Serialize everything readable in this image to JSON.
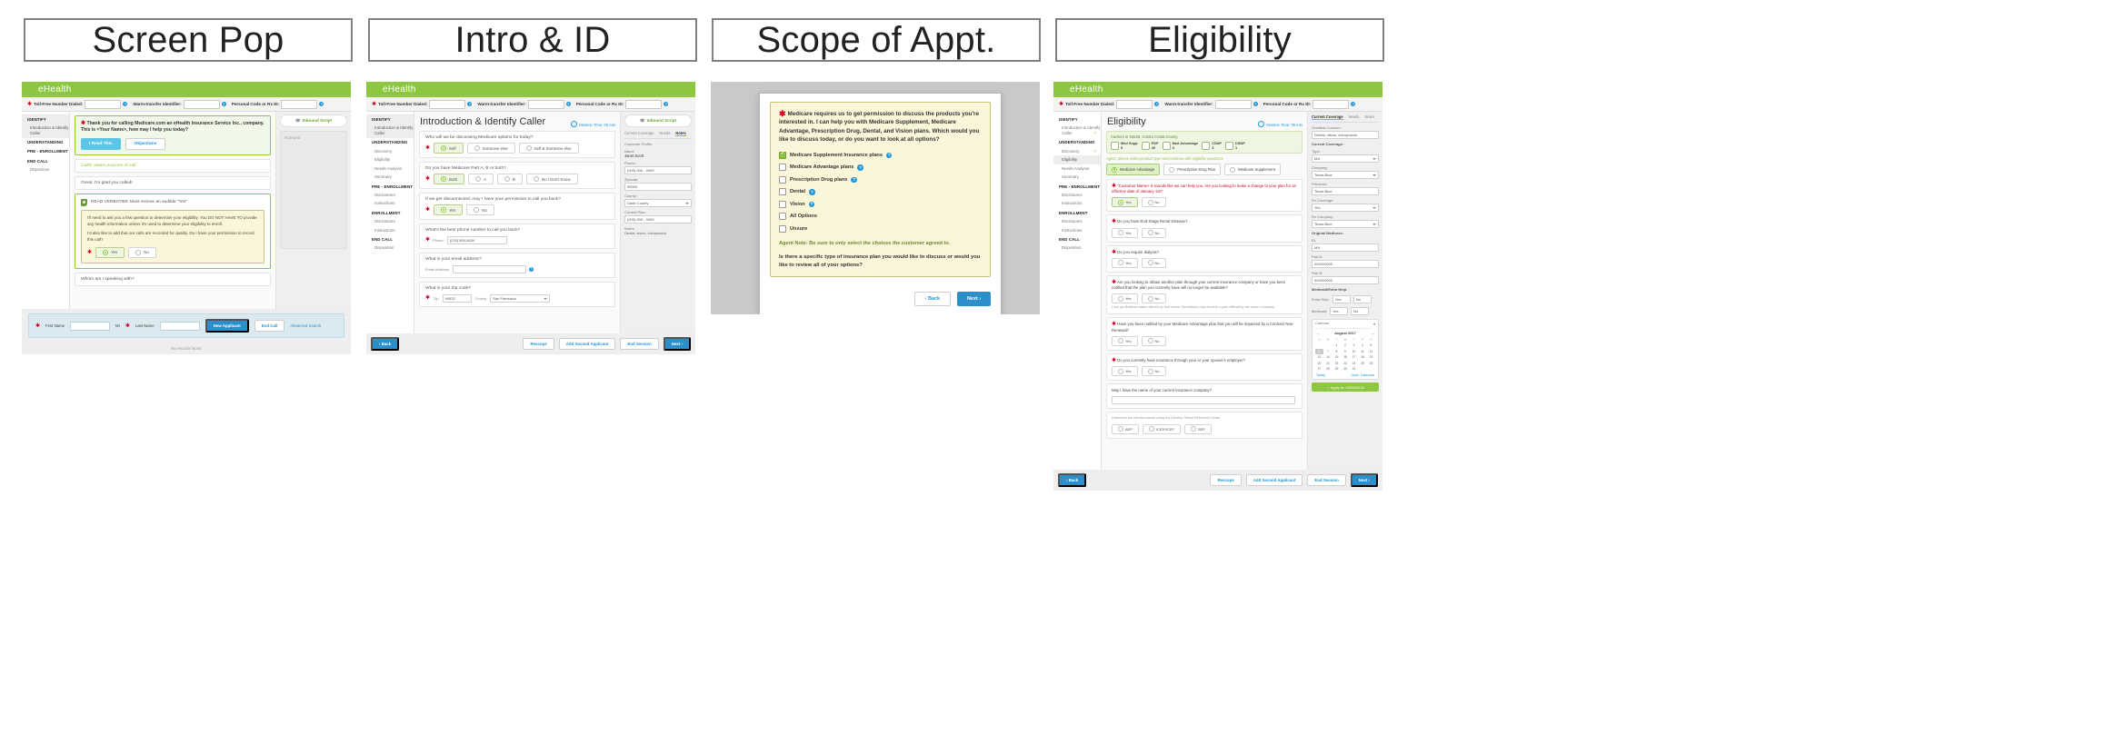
{
  "headers": [
    {
      "label": "Screen Pop"
    },
    {
      "label": "Intro & ID"
    },
    {
      "label": "Scope of Appt."
    },
    {
      "label": "Eligibility"
    }
  ],
  "brand": "eHealth",
  "topbar": {
    "toll_free_label": "Toll-Free Number Dialed:",
    "warm_transfer_label": "Warm-transfer Identifier:",
    "personal_code_label": "Personal Code or Rx ID:",
    "help_icon": "question-mark-icon"
  },
  "nav": {
    "identify": "IDENTIFY",
    "intro_identify": "Introduction & Identify Caller",
    "understanding": "UNDERSTANDING",
    "discovery": "Discovery",
    "eligibility": "Eligibility",
    "needs_analysis": "Needs Analysis",
    "summary": "Summary",
    "pre_enrollment": "PRE - ENROLLMENT",
    "disclosures": "Disclosures",
    "instructions": "Instructions",
    "enrollment": "ENROLLMENT",
    "end_call": "END CALL",
    "disposition": "Disposition"
  },
  "panel1": {
    "greeting": "Thank you for calling Medicare.com an eHealth Insurance Service Inc., company. This is <Your Name>, how may I help you today?",
    "btn_read": "I Read This",
    "btn_objections": "Objections",
    "caller_purpose": "Caller states purpose of call",
    "glad": "Great, I'm glad you called!",
    "verbatim": "READ VERBATIM!: Must recieve an audible \"Yes\"",
    "yellow_p1": "I'll need to ask you a few question to determine your eligibility. You DO NOT HAVE TO provide any health information unless it's used to determine your eligibility to enroll.",
    "yellow_p2": "I'd also like to add that our calls are recorded for quality. Do I have your permission to record this call?",
    "yes": "Yes",
    "no": "No",
    "whom": "Whom am I speaking with?",
    "search": {
      "first_name": "First Name",
      "mi": "MI",
      "last_name": "Last Name",
      "new_applicant": "New Applicant",
      "end_call": "End Call",
      "advanced_search": "Advanced Search"
    },
    "no_records": "No records found",
    "inbound_script": "Inbound Script",
    "notepad": "Notepad"
  },
  "panel2": {
    "title": "Introduction & Identify Caller",
    "session_time": "Session Time: 05 min",
    "q_discussing": "Who will we be discussing Medicare options for today?",
    "opt_self": "Self",
    "opt_someone": "Someone else",
    "opt_self_someone": "Self & Someone else",
    "q_partab": "Do you have Medicare Part A, B or both?",
    "opt_both": "Both",
    "opt_a": "A",
    "opt_b": "B",
    "opt_nodk": "No / Don't Know",
    "q_disconnect": "If we get disconnected, may I have your permission to call you back?",
    "q_bestphone": "What's the best phone number to call you back?",
    "phone_label": "Phone:",
    "phone_value": "(215) 555-5434",
    "q_email": "What is your email address?",
    "email_label": "Email Address:",
    "q_zip": "What is your Zip code?",
    "zip_label": "Zip",
    "zip_value": "94532",
    "county_label": "County",
    "county_value": "San Francisco",
    "footer": {
      "back": "Back",
      "rescope": "Rescope",
      "add_second": "Add Second Applicant",
      "end_call": "End Session",
      "next": "Next"
    },
    "right": {
      "tab_current_coverage": "Current Coverage",
      "tab_needs": "Needs",
      "tab_notes": "Notes",
      "customer_profile": "Customer Profile:",
      "name_label": "Name",
      "name_value": "Janet Scott",
      "phone_label": "Phone:",
      "phone_value": "(000) 000 - 0000",
      "zipcode_label": "Zipcode:",
      "zipcode_value": "90000",
      "county_label": "County:",
      "county_value": "Dade County",
      "current_plan": "Current Plan:",
      "current_plan_value": "(000) 000 - 0000",
      "notes_label": "Notes:",
      "notes_value": "Dental, vision, chiropractor",
      "inbound_script": "Inbound Script"
    }
  },
  "panel3": {
    "modal_title": "Medicare requires us to get permission to discuss the products you're interested in.  I can help you with Medicare Supplement, Medicare Advantage, Prescription Drug, Dental, and Vision plans.  Which would you like to discuss today, or do you want to look at all options?",
    "options": [
      {
        "label": "Medicare Supplement Insurance plans",
        "checked": true
      },
      {
        "label": "Medicare Advantage plans",
        "checked": false
      },
      {
        "label": "Prescription Drug plans",
        "checked": false
      },
      {
        "label": "Dental",
        "checked": false
      },
      {
        "label": "Vision",
        "checked": false
      },
      {
        "label": "All Options",
        "checked": false
      },
      {
        "label": "Unsure",
        "checked": false
      }
    ],
    "agent_note": "Agent Note: Be sure to only select the choices the customer agreed to.",
    "question": "Is there a specific type of insurance plan you would like to discuss or would you like to review all of your options?",
    "btn_back": "Back",
    "btn_next": "Next"
  },
  "panel4": {
    "title": "Eligibility",
    "session_time": "Session Time: 05 min",
    "coverage_title": "Carriers in 94526, Contra Costa County",
    "coverage_items": [
      {
        "name": "Med Supp",
        "count": "5",
        "icon": "document-icon"
      },
      {
        "name": "PDP",
        "count": "40",
        "icon": "pill-icon"
      },
      {
        "name": "Med Advantage",
        "count": "3",
        "icon": "wheel-icon"
      },
      {
        "name": "CSNP",
        "count": "3",
        "icon": "briefcase-icon"
      },
      {
        "name": "DSNP",
        "count": "1",
        "icon": "shield-icon"
      }
    ],
    "hint": "Agent, please select product type and continue with eligibility questions",
    "products": [
      {
        "label": "Medicare Advantage",
        "selected": true
      },
      {
        "label": "Prescription Drug Plan",
        "selected": false
      },
      {
        "label": "Medicare Supplement",
        "selected": false
      }
    ],
    "q1": "\"Customer Name> It sounds like we can help you. Are you looking to make a change to your plan for an effective date of January 1st?",
    "q2": "Do you have End-Stage Renal Disease?",
    "q3": "Do you require dialysis?",
    "q4": "Are you looking to obtain another plan through your current insurance company or have you been notified that the plan you currently have will no longer be available?",
    "q4_note": "Look up Medicare plans offered by that carrier. Beneficiary may enroll in a plan offered by the same Company.",
    "q5": "Have you been notified by your Medicare Advantage plan that you will be impacted by a Contract Non-Renewal?",
    "q6": "Do you currently have insurance through your or your spouse's employer?",
    "q7": "May I have the name of your current insurance company?",
    "q7_note": "Determine the election period using the Election Period Reference Guide.",
    "chips": [
      "AEP",
      "ICEP/ICEP",
      "SEP"
    ],
    "yes": "Yes",
    "no": "No",
    "right": {
      "tab_current_coverage": "Current Coverage",
      "tab_needs": "Needs",
      "tab_notes": "Notes",
      "greatest_concern": "Greatest Concern:",
      "greatest_concern_value": "Dental, vision, chiropractor",
      "current_coverage": "Current Coverage:",
      "type_label": "Type:",
      "type_value": "MA",
      "company_label": "Company:",
      "company_value": "Texas Blue",
      "premium_label": "Premium:",
      "premium_value": "Texas Blue",
      "rx_coverage_label": "Rx Coverage:",
      "rx_coverage_value": "Yes",
      "rx_company_label": "Rx Company:",
      "rx_company_value": "Texas Blue",
      "original_medicare": "Original Medicare:",
      "id_label": "ID:",
      "id_value": "MA",
      "part_a_label": "Part A:",
      "part_a_value": "00/00/0000",
      "part_b_label": "Part B:",
      "part_b_value": "00/00/0000",
      "extra_help_title": "Medicaid/Extra Help:",
      "extra_help_label": "Extra Help:",
      "medicaid_label": "Medicaid:",
      "yes": "Yes",
      "no": "No",
      "calendar_label": "Calendar",
      "month": "August 2017",
      "dows": [
        "S",
        "M",
        "T",
        "W",
        "T",
        "F",
        "S"
      ],
      "today": "Today",
      "open_calendar": "Open Calendar",
      "apply_for": "Apply for 00/00/2018"
    },
    "footer": {
      "back": "Back",
      "rescope": "Rescope",
      "add_second": "Add Second Applicant",
      "end_call": "End Session",
      "next": "Next"
    }
  },
  "colors": {
    "brand_green": "#8dc63f",
    "accent_blue": "#2196d6",
    "required_red": "#d0021b",
    "yellow_bg": "#fbf6d9"
  }
}
